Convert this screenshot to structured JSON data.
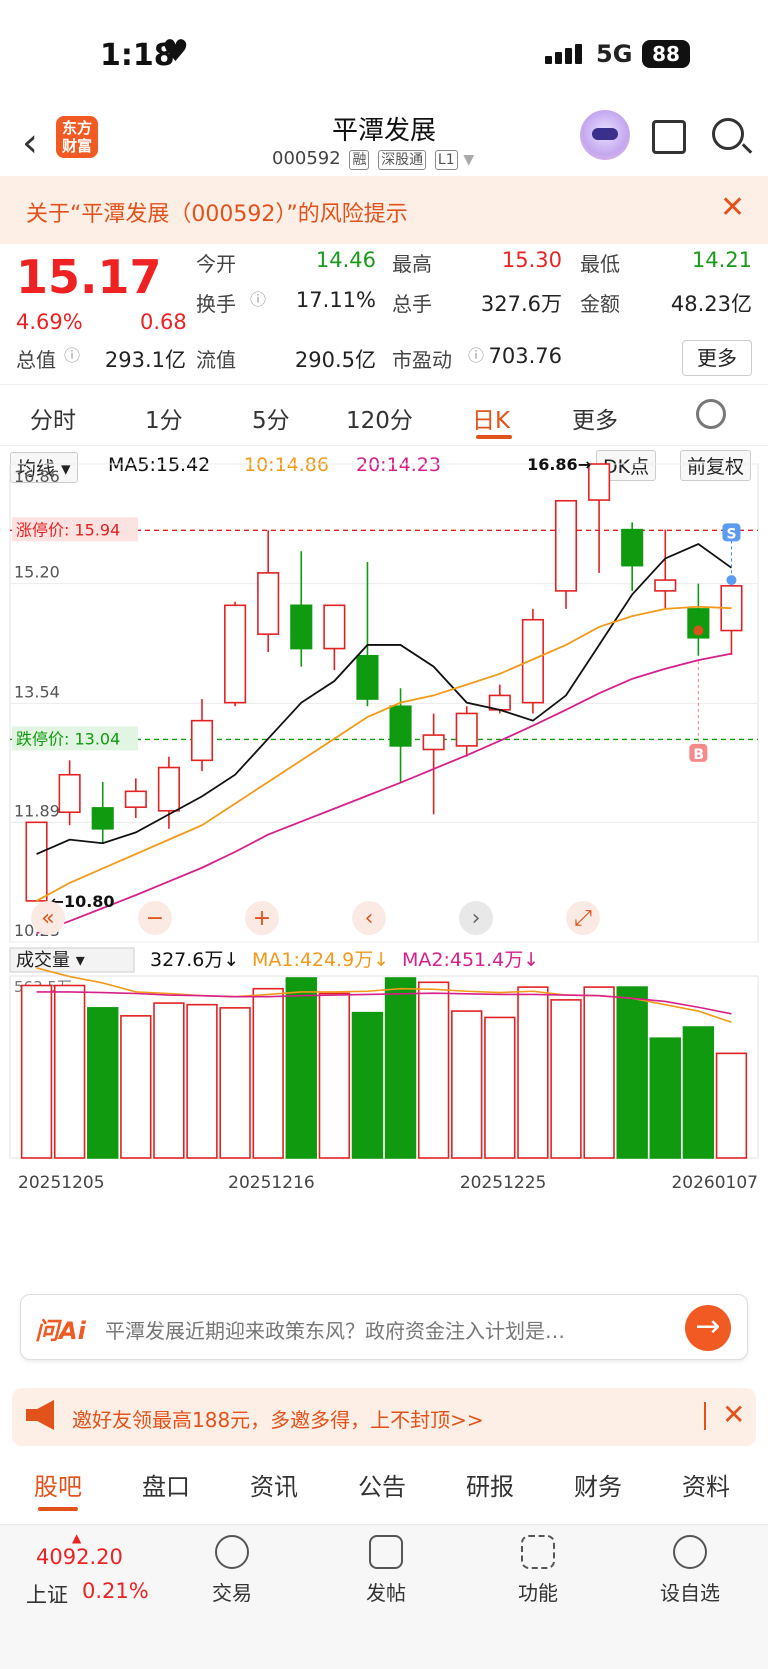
{
  "status": {
    "time": "1:18",
    "network": "5G",
    "battery": "88"
  },
  "header": {
    "logo": "东方\n财富",
    "title": "平潭发展",
    "code": "000592",
    "tags": [
      "融",
      "深股通",
      "L1"
    ]
  },
  "risk_banner": {
    "text": "关于“平潭发展（000592）”的风险提示"
  },
  "quote": {
    "price": "15.17",
    "change_pct": "4.69%",
    "change": "0.68",
    "fields": [
      {
        "label": "今开",
        "value": "14.46",
        "color": "#1a9a1a"
      },
      {
        "label": "最高",
        "value": "15.30",
        "color": "#e22222"
      },
      {
        "label": "最低",
        "value": "14.21",
        "color": "#1a9a1a"
      },
      {
        "label": "换手",
        "value": "17.11%",
        "color": "#222222"
      },
      {
        "label": "总手",
        "value": "327.6万",
        "color": "#222222"
      },
      {
        "label": "金额",
        "value": "48.23亿",
        "color": "#222222"
      },
      {
        "label": "总值",
        "value": "293.1亿",
        "color": "#222222"
      },
      {
        "label": "流值",
        "value": "290.5亿",
        "color": "#222222"
      },
      {
        "label": "市盈动",
        "value": "703.76",
        "color": "#222222"
      }
    ],
    "more": "更多"
  },
  "tabs": [
    "分时",
    "1分",
    "5分",
    "120分",
    "日K",
    "更多"
  ],
  "active_tab": "日K",
  "chart_data": [
    {
      "type": "candlestick",
      "title": "日K",
      "indicator": "均线",
      "ma_labels": {
        "ma5": "MA5:15.42",
        "ma10": "10:14.86",
        "ma20": "20:14.23"
      },
      "controls": {
        "dk": "DK点",
        "adjust": "前复权"
      },
      "y_ticks": [
        "16.86",
        "15.20",
        "13.54",
        "11.89",
        "10.23"
      ],
      "ylim": [
        10.23,
        16.86
      ],
      "limit_up": {
        "label": "涨停价: 15.94",
        "value": 15.94
      },
      "limit_down": {
        "label": "跌停价: 13.04",
        "value": 13.04
      },
      "annotations": {
        "high": "16.86",
        "low": "10.80",
        "sell_marker": "S",
        "buy_marker": "B"
      },
      "x_labels": [
        "20251205",
        "20251216",
        "20251225",
        "20260107"
      ],
      "candles": [
        {
          "o": 10.8,
          "h": 11.89,
          "l": 10.8,
          "c": 11.89
        },
        {
          "o": 12.03,
          "h": 12.75,
          "l": 11.85,
          "c": 12.55
        },
        {
          "o": 12.09,
          "h": 12.45,
          "l": 11.6,
          "c": 11.8
        },
        {
          "o": 12.1,
          "h": 12.5,
          "l": 11.95,
          "c": 12.32
        },
        {
          "o": 12.05,
          "h": 12.8,
          "l": 11.8,
          "c": 12.65
        },
        {
          "o": 12.75,
          "h": 13.6,
          "l": 12.6,
          "c": 13.3
        },
        {
          "o": 13.55,
          "h": 14.95,
          "l": 13.5,
          "c": 14.9
        },
        {
          "o": 14.5,
          "h": 15.94,
          "l": 14.25,
          "c": 15.35
        },
        {
          "o": 14.9,
          "h": 15.65,
          "l": 14.05,
          "c": 14.3
        },
        {
          "o": 14.3,
          "h": 14.9,
          "l": 14.0,
          "c": 14.9
        },
        {
          "o": 14.2,
          "h": 15.5,
          "l": 13.5,
          "c": 13.6
        },
        {
          "o": 13.5,
          "h": 13.75,
          "l": 12.45,
          "c": 12.95
        },
        {
          "o": 12.9,
          "h": 13.4,
          "l": 12.0,
          "c": 13.1
        },
        {
          "o": 12.95,
          "h": 13.5,
          "l": 12.8,
          "c": 13.4
        },
        {
          "o": 13.45,
          "h": 13.8,
          "l": 13.4,
          "c": 13.65
        },
        {
          "o": 13.55,
          "h": 14.85,
          "l": 13.4,
          "c": 14.7
        },
        {
          "o": 15.1,
          "h": 16.35,
          "l": 14.85,
          "c": 16.35
        },
        {
          "o": 16.36,
          "h": 16.86,
          "l": 15.35,
          "c": 16.86
        },
        {
          "o": 15.95,
          "h": 16.05,
          "l": 15.1,
          "c": 15.45
        },
        {
          "o": 15.1,
          "h": 15.95,
          "l": 14.85,
          "c": 15.25
        },
        {
          "o": 14.85,
          "h": 15.2,
          "l": 14.2,
          "c": 14.45
        },
        {
          "o": 14.55,
          "h": 15.17,
          "l": 14.21,
          "c": 15.17
        }
      ],
      "ma5": [
        11.45,
        11.65,
        11.6,
        11.75,
        12.0,
        12.25,
        12.55,
        13.05,
        13.55,
        13.85,
        14.35,
        14.35,
        14.05,
        13.55,
        13.45,
        13.3,
        13.65,
        14.35,
        15.05,
        15.55,
        15.75,
        15.42
      ],
      "ma10": [
        10.8,
        11.05,
        11.25,
        11.45,
        11.65,
        11.85,
        12.15,
        12.45,
        12.75,
        13.05,
        13.35,
        13.55,
        13.65,
        13.8,
        13.95,
        14.15,
        14.35,
        14.6,
        14.75,
        14.85,
        14.88,
        14.86
      ],
      "ma20": [
        10.35,
        10.52,
        10.7,
        10.88,
        11.07,
        11.26,
        11.48,
        11.72,
        11.9,
        12.08,
        12.26,
        12.44,
        12.63,
        12.82,
        13.02,
        13.23,
        13.45,
        13.68,
        13.88,
        14.02,
        14.14,
        14.23
      ]
    },
    {
      "type": "bar",
      "title": "成交量",
      "labels": {
        "vol": "327.6万",
        "ma1": "MA1:424.9万",
        "ma2": "MA2:451.4万"
      },
      "max_label": "563.5万",
      "ylim": [
        0,
        563.5
      ],
      "values": [
        540,
        540,
        470,
        445,
        485,
        480,
        470,
        530,
        563.5,
        515,
        455,
        563.5,
        550,
        460,
        440,
        535,
        495,
        535,
        535,
        375,
        410,
        327.6
      ],
      "up": [
        true,
        true,
        false,
        true,
        true,
        true,
        true,
        true,
        false,
        true,
        false,
        false,
        true,
        true,
        true,
        true,
        true,
        true,
        false,
        false,
        false,
        true
      ],
      "ma1": [
        595,
        568,
        548,
        520,
        515,
        508,
        505,
        512,
        520,
        520,
        522,
        530,
        528,
        522,
        518,
        522,
        510,
        508,
        500,
        480,
        460,
        424.9
      ],
      "ma2": [
        520,
        520,
        518,
        515,
        510,
        508,
        505,
        505,
        508,
        510,
        512,
        514,
        516,
        514,
        512,
        512,
        510,
        508,
        500,
        490,
        472,
        451.4
      ]
    }
  ],
  "ask_ai": {
    "brand": "问Ai",
    "question": "平潭发展近期迎来政策东风？政府资金注入计划是…"
  },
  "promo": {
    "text": "邀好友领最高188元，多邀多得，上不封顶>>"
  },
  "bottom_tabs": [
    "股吧",
    "盘口",
    "资讯",
    "公告",
    "研报",
    "财务",
    "资料"
  ],
  "active_bottom_tab": "股吧",
  "index": {
    "value": "4092.20",
    "name": "上证",
    "pct": "0.21%"
  },
  "dock": [
    {
      "icon": "trade-icon",
      "label": "交易"
    },
    {
      "icon": "post-icon",
      "label": "发帖"
    },
    {
      "icon": "grid-icon",
      "label": "功能"
    },
    {
      "icon": "more-icon",
      "label": "设自选"
    }
  ],
  "colors": {
    "up": "#e22222",
    "down": "#0f9a0f",
    "accent": "#f15a22",
    "ma5": "#111111",
    "ma10": "#f29a1a",
    "ma20": "#d6208c"
  }
}
